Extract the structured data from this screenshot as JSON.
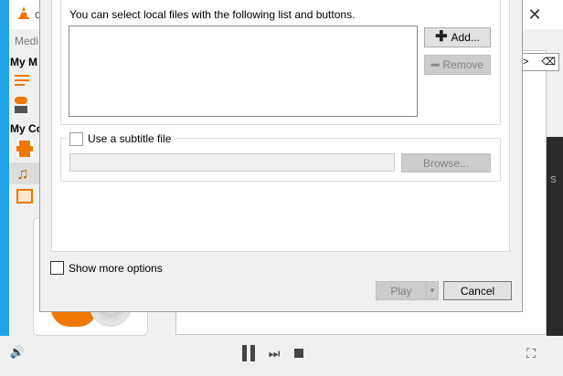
{
  "background": {
    "title_fragment": "d",
    "sidebar": {
      "media_fragment": "Medi",
      "section1": "My M",
      "section2": "My Co",
      "item_fragment_1": "P",
      "item_fragment_2": "M"
    },
    "search_fragment": ">",
    "side_fragment": "S"
  },
  "dialog": {
    "hint": "You can select local files with the following list and buttons.",
    "add_label": "Add...",
    "remove_label": "Remove",
    "subtitle_label": "Use a subtitle file",
    "browse_label": "Browse...",
    "show_more_label": "Show more options",
    "play_label": "Play",
    "cancel_label": "Cancel"
  },
  "colors": {
    "accent_blue": "#1fa3e7",
    "vlc_orange": "#f07800"
  }
}
